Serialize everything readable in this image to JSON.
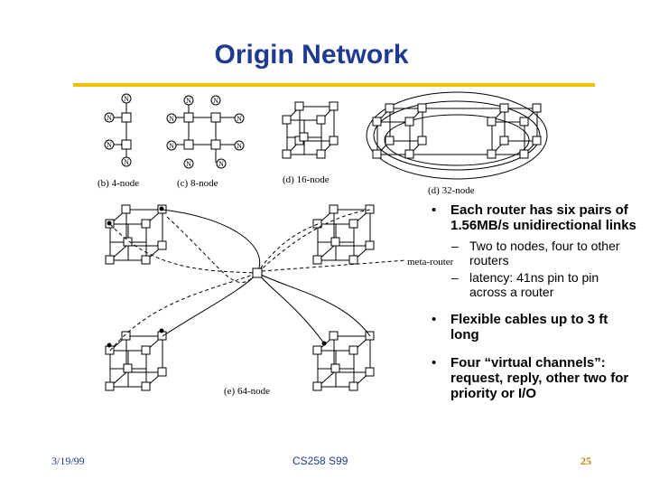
{
  "slide": {
    "title": "Origin Network",
    "accent_color": "#f0c000",
    "title_color": "#1f3a93"
  },
  "figure": {
    "captions": {
      "four_node": "(b) 4-node",
      "eight_node": "(c) 8-node",
      "sixteen_node": "(d) 16-node",
      "thirty_two_node": "(d) 32-node",
      "sixty_four_node": "(e) 64-node",
      "meta_router": "meta-router"
    },
    "node_label": "N"
  },
  "bullets": [
    {
      "text": "Each router has six pairs of 1.56MB/s unidirectional links",
      "sub": [
        "Two to nodes, four to other routers",
        "latency: 41ns pin to pin across a router"
      ]
    },
    {
      "text": "Flexible cables up to 3 ft long",
      "sub": []
    },
    {
      "text": "Four “virtual channels”: request, reply, other two for priority or I/O",
      "sub": []
    }
  ],
  "footer": {
    "date": "3/19/99",
    "course": "CS258 S99",
    "page": "25"
  }
}
